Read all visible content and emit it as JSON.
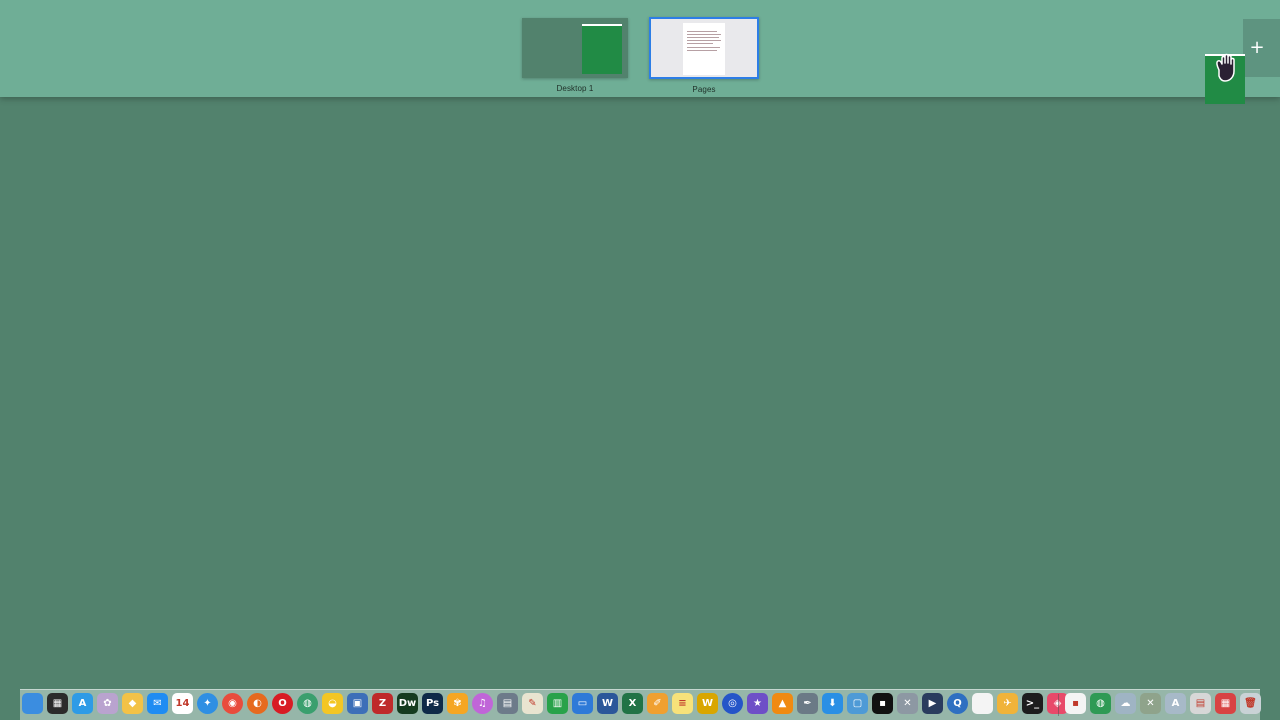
{
  "spaces": [
    {
      "label": "Desktop 1"
    },
    {
      "label": "Pages"
    }
  ],
  "add_space": {
    "icon": "plus-icon",
    "label": "+"
  },
  "cursor": {
    "icon": "hand-grab-cursor-icon"
  },
  "colors": {
    "desktop": "#52826d",
    "spaces_bar": "#6fae96",
    "selection": "#2d7ee6",
    "window": "#218b45"
  },
  "dock": {
    "apps": [
      {
        "name": "finder",
        "icon": "finder-icon",
        "color": "#3b8de0",
        "glyph": ""
      },
      {
        "name": "launchpad",
        "icon": "launchpad-icon",
        "color": "#2b2b2b",
        "glyph": "▦"
      },
      {
        "name": "app-store",
        "icon": "app-store-icon",
        "color": "#2e9be6",
        "glyph": "A"
      },
      {
        "name": "photo-app",
        "icon": "photo-app-icon",
        "color": "#b9a3cf",
        "glyph": "✿"
      },
      {
        "name": "sketch",
        "icon": "sketch-icon",
        "color": "#f3c247",
        "glyph": "◆"
      },
      {
        "name": "messenger",
        "icon": "messenger-icon",
        "color": "#1f8cf2",
        "glyph": "✉"
      },
      {
        "name": "calendar",
        "icon": "calendar-icon",
        "color": "#ffffff",
        "glyph": "14"
      },
      {
        "name": "safari",
        "icon": "safari-icon",
        "color": "#2f8fe3",
        "glyph": "✦"
      },
      {
        "name": "chrome",
        "icon": "chrome-icon",
        "color": "#e84c3d",
        "glyph": "◉"
      },
      {
        "name": "firefox",
        "icon": "firefox-icon",
        "color": "#e66a1f",
        "glyph": "◐"
      },
      {
        "name": "opera",
        "icon": "opera-icon",
        "color": "#d81c24",
        "glyph": "O"
      },
      {
        "name": "network",
        "icon": "network-globe-icon",
        "color": "#3a9f6e",
        "glyph": "◍"
      },
      {
        "name": "cyberduck",
        "icon": "cyberduck-icon",
        "color": "#f3c624",
        "glyph": "◒"
      },
      {
        "name": "remote-desktop",
        "icon": "remote-desktop-icon",
        "color": "#3d6fb8",
        "glyph": "▣"
      },
      {
        "name": "filezilla",
        "icon": "filezilla-icon",
        "color": "#bf2a2a",
        "glyph": "Z"
      },
      {
        "name": "dreamweaver",
        "icon": "dreamweaver-icon",
        "color": "#153b1f",
        "glyph": "Dw"
      },
      {
        "name": "photoshop",
        "icon": "photoshop-icon",
        "color": "#0f2a48",
        "glyph": "Ps"
      },
      {
        "name": "photos",
        "icon": "photos-icon",
        "color": "#f5a623",
        "glyph": "✾"
      },
      {
        "name": "itunes",
        "icon": "itunes-icon",
        "color": "#c065d8",
        "glyph": "♫"
      },
      {
        "name": "image-capture",
        "icon": "image-capture-icon",
        "color": "#6d7b8a",
        "glyph": "▤"
      },
      {
        "name": "textedit",
        "icon": "textedit-icon",
        "color": "#e9e4d0",
        "glyph": "✎"
      },
      {
        "name": "numbers",
        "icon": "numbers-icon",
        "color": "#28a24a",
        "glyph": "▥"
      },
      {
        "name": "keynote",
        "icon": "keynote-icon",
        "color": "#2e7ad8",
        "glyph": "▭"
      },
      {
        "name": "word",
        "icon": "word-icon",
        "color": "#2b579a",
        "glyph": "W"
      },
      {
        "name": "excel",
        "icon": "excel-icon",
        "color": "#217346",
        "glyph": "X"
      },
      {
        "name": "pages",
        "icon": "pages-icon",
        "color": "#f0a030",
        "glyph": "✐"
      },
      {
        "name": "notes",
        "icon": "notes-icon",
        "color": "#f7e27a",
        "glyph": "≡"
      },
      {
        "name": "wunderlist",
        "icon": "wunderlist-icon",
        "color": "#d9a600",
        "glyph": "W"
      },
      {
        "name": "clock-app",
        "icon": "clock-app-icon",
        "color": "#2555c8",
        "glyph": "◎"
      },
      {
        "name": "imovie",
        "icon": "imovie-star-icon",
        "color": "#6e4fc7",
        "glyph": "★"
      },
      {
        "name": "vlc",
        "icon": "vlc-icon",
        "color": "#f08a12",
        "glyph": "▲"
      },
      {
        "name": "script-editor",
        "icon": "script-editor-icon",
        "color": "#6b7a86",
        "glyph": "✒"
      },
      {
        "name": "downloader",
        "icon": "download-icon",
        "color": "#2a8fe5",
        "glyph": "⬇"
      },
      {
        "name": "preview",
        "icon": "preview-icon",
        "color": "#4e9ad6",
        "glyph": "▢"
      },
      {
        "name": "console",
        "icon": "console-icon",
        "color": "#111111",
        "glyph": "▪"
      },
      {
        "name": "system-tools",
        "icon": "system-tools-icon",
        "color": "#8d98a3",
        "glyph": "✕"
      },
      {
        "name": "quicktime-player",
        "icon": "quicktime-icon",
        "color": "#2a3c5e",
        "glyph": "▶"
      },
      {
        "name": "quicktime",
        "icon": "quicktime-q-icon",
        "color": "#2f6fc1",
        "glyph": "Q"
      },
      {
        "name": "blank-document",
        "icon": "document-icon",
        "color": "#f4f4f4",
        "glyph": ""
      },
      {
        "name": "feather",
        "icon": "feather-icon",
        "color": "#f0b33a",
        "glyph": "✈"
      },
      {
        "name": "terminal",
        "icon": "terminal-icon",
        "color": "#1d1d1d",
        "glyph": ">_"
      },
      {
        "name": "color-picker",
        "icon": "color-picker-icon",
        "color": "#e84a6a",
        "glyph": "◈"
      }
    ],
    "others": [
      {
        "name": "stack-doc",
        "icon": "document-stack-icon",
        "color": "#f4f4f4",
        "glyph": "▪"
      },
      {
        "name": "stack-network",
        "icon": "network-stack-icon",
        "color": "#2f9a55",
        "glyph": "◍"
      },
      {
        "name": "stack-cloud",
        "icon": "cloud-stack-icon",
        "color": "#9fb4c4",
        "glyph": "☁"
      },
      {
        "name": "stack-tools",
        "icon": "tools-stack-icon",
        "color": "#8fa38b",
        "glyph": "✕"
      },
      {
        "name": "stack-apps",
        "icon": "applications-stack-icon",
        "color": "#a7b9c8",
        "glyph": "A"
      },
      {
        "name": "stack-documents",
        "icon": "documents-stack-icon",
        "color": "#d7d7d7",
        "glyph": "▤"
      },
      {
        "name": "stack-downloads",
        "icon": "downloads-stack-icon",
        "color": "#d84343",
        "glyph": "▦"
      },
      {
        "name": "trash",
        "icon": "trash-icon",
        "color": "#c9d2d6",
        "glyph": "🗑"
      }
    ]
  }
}
